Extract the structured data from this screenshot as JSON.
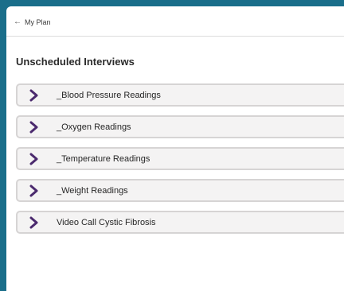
{
  "header": {
    "back_label": "My Plan"
  },
  "section": {
    "title": "Unscheduled Interviews"
  },
  "items": [
    {
      "label": "_Blood Pressure Readings"
    },
    {
      "label": "_Oxygen Readings"
    },
    {
      "label": "_Temperature Readings"
    },
    {
      "label": "_Weight Readings"
    },
    {
      "label": "Video Call Cystic Fibrosis"
    }
  ],
  "colors": {
    "background": "#1a6e8a",
    "chevron": "#4b2a6e",
    "item_bg": "#f4f3f3",
    "item_border": "#d6d4d4"
  }
}
